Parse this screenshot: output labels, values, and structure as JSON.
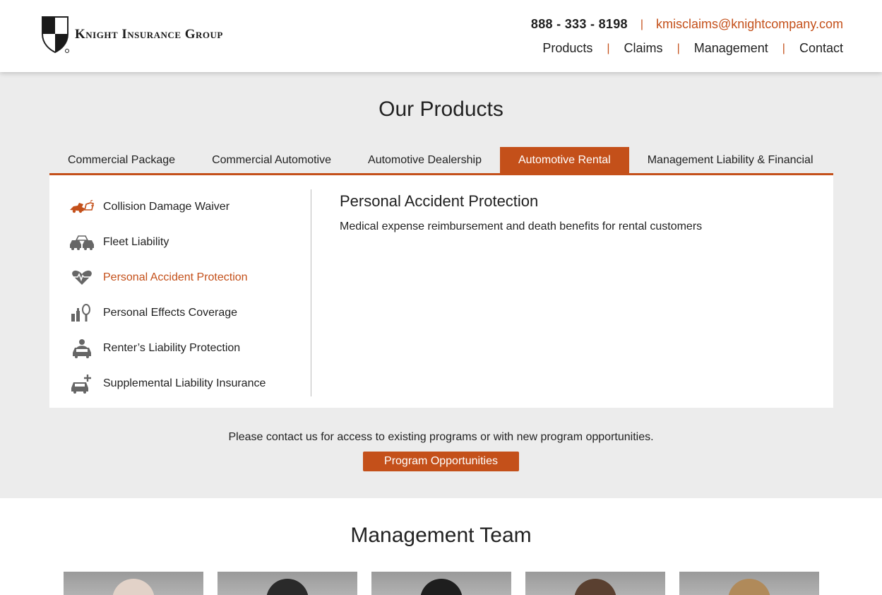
{
  "header": {
    "logo_text": "Knight Insurance Group",
    "phone": "888 - 333 - 8198",
    "email": "kmisclaims@knightcompany.com",
    "nav": [
      "Products",
      "Claims",
      "Management",
      "Contact"
    ]
  },
  "products": {
    "title": "Our Products",
    "tabs": [
      {
        "label": "Commercial Package",
        "active": false
      },
      {
        "label": "Commercial Automotive",
        "active": false
      },
      {
        "label": "Automotive Dealership",
        "active": false
      },
      {
        "label": "Automotive Rental",
        "active": true
      },
      {
        "label": "Management Liability & Financial",
        "active": false
      }
    ],
    "items": [
      {
        "label": "Collision Damage Waiver",
        "icon": "car-crash-icon",
        "active": false
      },
      {
        "label": "Fleet Liability",
        "icon": "fleet-cars-icon",
        "active": false
      },
      {
        "label": "Personal Accident Protection",
        "icon": "heartbeat-icon",
        "active": true
      },
      {
        "label": "Personal Effects Coverage",
        "icon": "personal-items-icon",
        "active": false
      },
      {
        "label": "Renter’s Liability Protection",
        "icon": "car-person-icon",
        "active": false
      },
      {
        "label": "Supplemental Liability Insurance",
        "icon": "car-plus-icon",
        "active": false
      }
    ],
    "detail": {
      "title": "Personal Accident Protection",
      "description": "Medical expense reimbursement and death benefits for rental customers"
    },
    "contact_note": "Please contact us for access to existing programs or with new program opportunities.",
    "cta_label": "Program Opportunities"
  },
  "management": {
    "title": "Management Team"
  },
  "colors": {
    "accent": "#c4501a",
    "background": "#ececec"
  }
}
